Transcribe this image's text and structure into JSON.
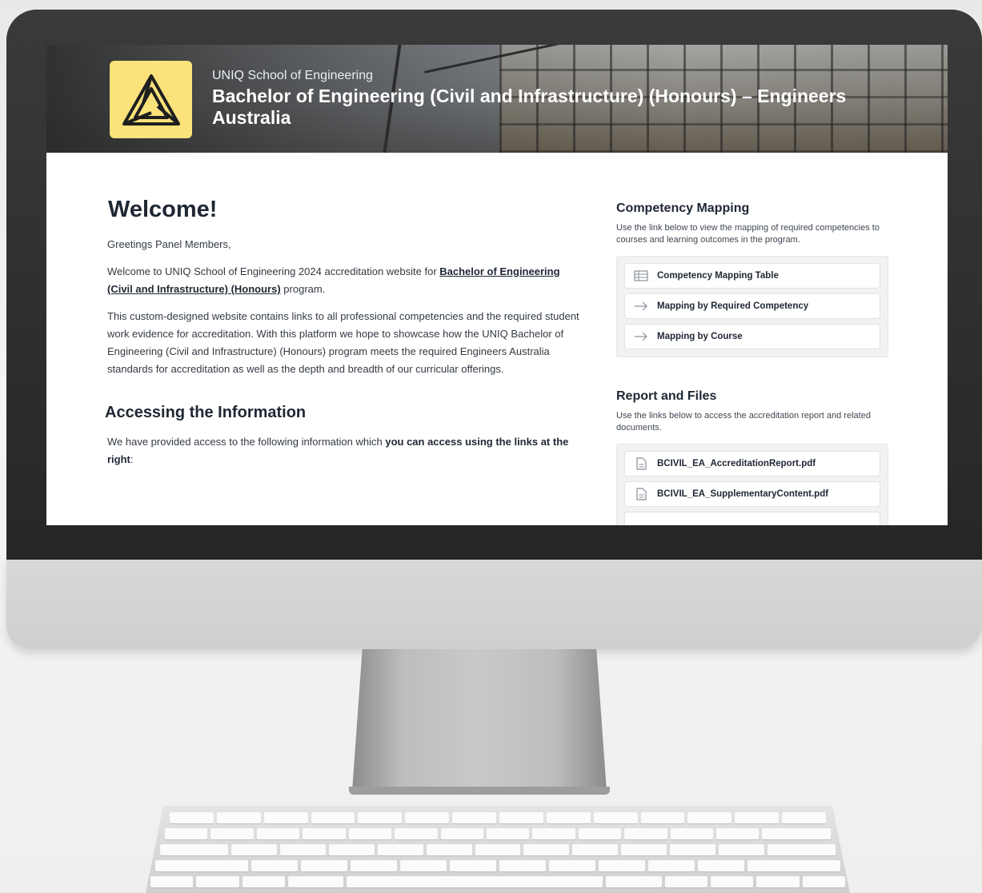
{
  "header": {
    "school": "UNIQ School of Engineering",
    "title": "Bachelor of Engineering (Civil and Infrastructure) (Honours) – Engineers Australia"
  },
  "main": {
    "welcome_heading": "Welcome!",
    "greeting": "Greetings Panel Members,",
    "intro_prefix": "Welcome to UNIQ School of Engineering 2024 accreditation website for ",
    "intro_link": "Bachelor of Engineering (Civil and Infrastructure) (Honours)",
    "intro_suffix": " program.",
    "description": "This custom-designed website contains links to all professional competencies and the required student work evidence for accreditation. With this platform we hope to showcase how the UNIQ Bachelor of Engineering (Civil and Infrastructure) (Honours) program meets the required Engineers Australia standards for accreditation as well as the depth and breadth of our curricular offerings.",
    "access_heading": "Accessing the Information",
    "access_prefix": "We have provided access to the following information which ",
    "access_bold": "you can access using the links at the right",
    "access_suffix": ":"
  },
  "competency": {
    "heading": "Competency Mapping",
    "description": "Use the link below to view the mapping of required competencies to courses and learning outcomes in the program.",
    "links": [
      {
        "label": "Competency Mapping Table",
        "icon": "table-icon"
      },
      {
        "label": "Mapping by Required Competency",
        "icon": "arrow-right-icon"
      },
      {
        "label": "Mapping by Course",
        "icon": "arrow-right-icon"
      }
    ]
  },
  "reports": {
    "heading": "Report and Files",
    "description": "Use the links below to access the accreditation report and related documents.",
    "files": [
      {
        "label": "BCIVIL_EA_AccreditationReport.pdf",
        "icon": "file-icon"
      },
      {
        "label": "BCIVIL_EA_SupplementaryContent.pdf",
        "icon": "file-icon"
      }
    ]
  },
  "colors": {
    "logo_bg": "#fbe27a",
    "heading": "#1f2733",
    "body_text": "#333a44"
  }
}
